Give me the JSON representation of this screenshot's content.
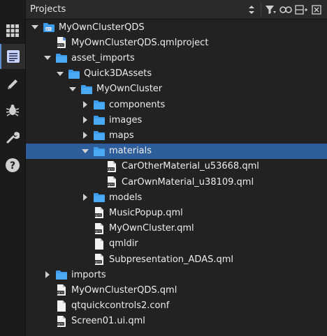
{
  "panel": {
    "title": "Projects"
  },
  "sidebar": {
    "modes": [
      {
        "icon": "grid-icon",
        "active": false
      },
      {
        "icon": "document-icon",
        "active": true
      },
      {
        "icon": "pencil-icon",
        "active": false
      },
      {
        "icon": "bug-icon",
        "active": false
      },
      {
        "icon": "wrench-icon",
        "active": false
      },
      {
        "icon": "help-icon",
        "active": false
      }
    ]
  },
  "header_buttons": [
    "sort-updown-icon",
    "filter-icon",
    "link-icon",
    "split-icon",
    "close-panel-icon"
  ],
  "tree": [
    {
      "label": "MyOwnClusterQDS",
      "depth": 0,
      "arrow": "open",
      "icon": "project-folder"
    },
    {
      "label": "MyOwnClusterQDS.qmlproject",
      "depth": 1,
      "arrow": "none",
      "icon": "qmlproject-file"
    },
    {
      "label": "asset_imports",
      "depth": 1,
      "arrow": "open",
      "icon": "folder"
    },
    {
      "label": "Quick3DAssets",
      "depth": 2,
      "arrow": "open",
      "icon": "folder"
    },
    {
      "label": "MyOwnCluster",
      "depth": 3,
      "arrow": "open",
      "icon": "folder"
    },
    {
      "label": "components",
      "depth": 4,
      "arrow": "closed",
      "icon": "folder"
    },
    {
      "label": "images",
      "depth": 4,
      "arrow": "closed",
      "icon": "folder"
    },
    {
      "label": "maps",
      "depth": 4,
      "arrow": "closed",
      "icon": "folder"
    },
    {
      "label": "materials",
      "depth": 4,
      "arrow": "open",
      "icon": "folder",
      "selected": true
    },
    {
      "label": "CarOtherMaterial_u53668.qml",
      "depth": 5,
      "arrow": "none",
      "icon": "qml-file"
    },
    {
      "label": "CarOwnMaterial_u38109.qml",
      "depth": 5,
      "arrow": "none",
      "icon": "qml-file"
    },
    {
      "label": "models",
      "depth": 4,
      "arrow": "closed",
      "icon": "folder"
    },
    {
      "label": "MusicPopup.qml",
      "depth": 4,
      "arrow": "none",
      "icon": "qml-file"
    },
    {
      "label": "MyOwnCluster.qml",
      "depth": 4,
      "arrow": "none",
      "icon": "qml-file"
    },
    {
      "label": "qmldir",
      "depth": 4,
      "arrow": "none",
      "icon": "plain-file"
    },
    {
      "label": "Subpresentation_ADAS.qml",
      "depth": 4,
      "arrow": "none",
      "icon": "qml-file"
    },
    {
      "label": "imports",
      "depth": 1,
      "arrow": "closed",
      "icon": "folder"
    },
    {
      "label": "MyOwnClusterQDS.qml",
      "depth": 1,
      "arrow": "none",
      "icon": "qml-file"
    },
    {
      "label": "qtquickcontrols2.conf",
      "depth": 1,
      "arrow": "none",
      "icon": "plain-file"
    },
    {
      "label": "Screen01.ui.qml",
      "depth": 1,
      "arrow": "none",
      "icon": "qml-file"
    }
  ],
  "colors": {
    "folder": "#3d9be9",
    "selection": "#2d5d9b",
    "panel_bg": "#222222"
  }
}
